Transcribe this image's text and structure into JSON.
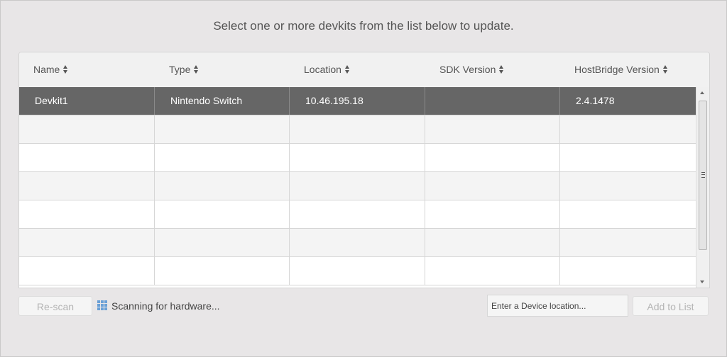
{
  "instruction": "Select one or more devkits from the list below to update.",
  "columns": [
    "Name",
    "Type",
    "Location",
    "SDK Version",
    "HostBridge Version"
  ],
  "rows": [
    {
      "name": "Devkit1",
      "type": "Nintendo Switch",
      "location": "10.46.195.18",
      "sdk_version": "",
      "hostbridge_version": "2.4.1478",
      "selected": true
    },
    {
      "name": "",
      "type": "",
      "location": "",
      "sdk_version": "",
      "hostbridge_version": ""
    },
    {
      "name": "",
      "type": "",
      "location": "",
      "sdk_version": "",
      "hostbridge_version": ""
    },
    {
      "name": "",
      "type": "",
      "location": "",
      "sdk_version": "",
      "hostbridge_version": ""
    },
    {
      "name": "",
      "type": "",
      "location": "",
      "sdk_version": "",
      "hostbridge_version": ""
    },
    {
      "name": "",
      "type": "",
      "location": "",
      "sdk_version": "",
      "hostbridge_version": ""
    },
    {
      "name": "",
      "type": "",
      "location": "",
      "sdk_version": "",
      "hostbridge_version": ""
    }
  ],
  "buttons": {
    "rescan": "Re-scan",
    "add_to_list": "Add to List"
  },
  "status": {
    "icon": "grid-icon",
    "text": "Scanning for hardware..."
  },
  "device_input": {
    "placeholder": "Enter a Device location...",
    "value": ""
  },
  "colors": {
    "selected_row": "#666666",
    "accent_icon": "#6aa0d6"
  }
}
